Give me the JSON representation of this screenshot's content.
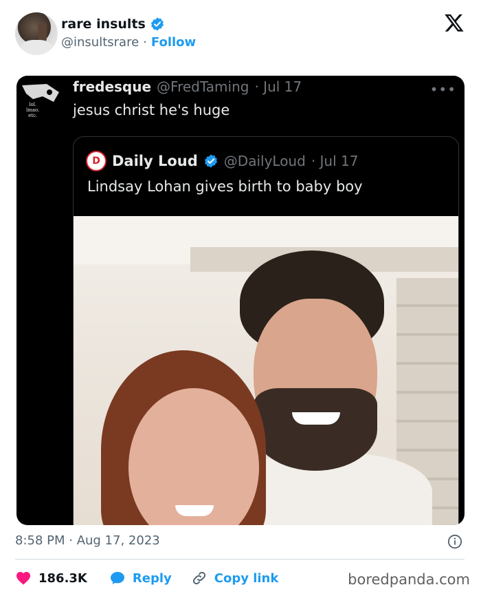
{
  "author": {
    "name": "rare insults",
    "handle": "@insultsrare",
    "separator": "·",
    "follow_label": "Follow"
  },
  "embedded_tweet": {
    "author_name": "fredesque",
    "author_handle": "@FredTaming",
    "date": "· Jul 17",
    "more": "•••",
    "text": "jesus christ he's huge",
    "avatar_text": "lol.\nlmao.\netc.",
    "quoted_tweet": {
      "author_name": "Daily Loud",
      "author_handle": "@DailyLoud",
      "date": "· Jul 17",
      "text": "Lindsay Lohan gives birth to baby boy"
    }
  },
  "footer": {
    "timestamp": "8:58 PM · Aug 17, 2023",
    "likes": "186.3K",
    "reply_label": "Reply",
    "copy_link_label": "Copy link"
  },
  "watermark": "boredpanda.com",
  "colors": {
    "accent": "#1d9bf0",
    "like": "#f91880",
    "text_secondary": "#536471",
    "dark_bg": "#000000"
  }
}
